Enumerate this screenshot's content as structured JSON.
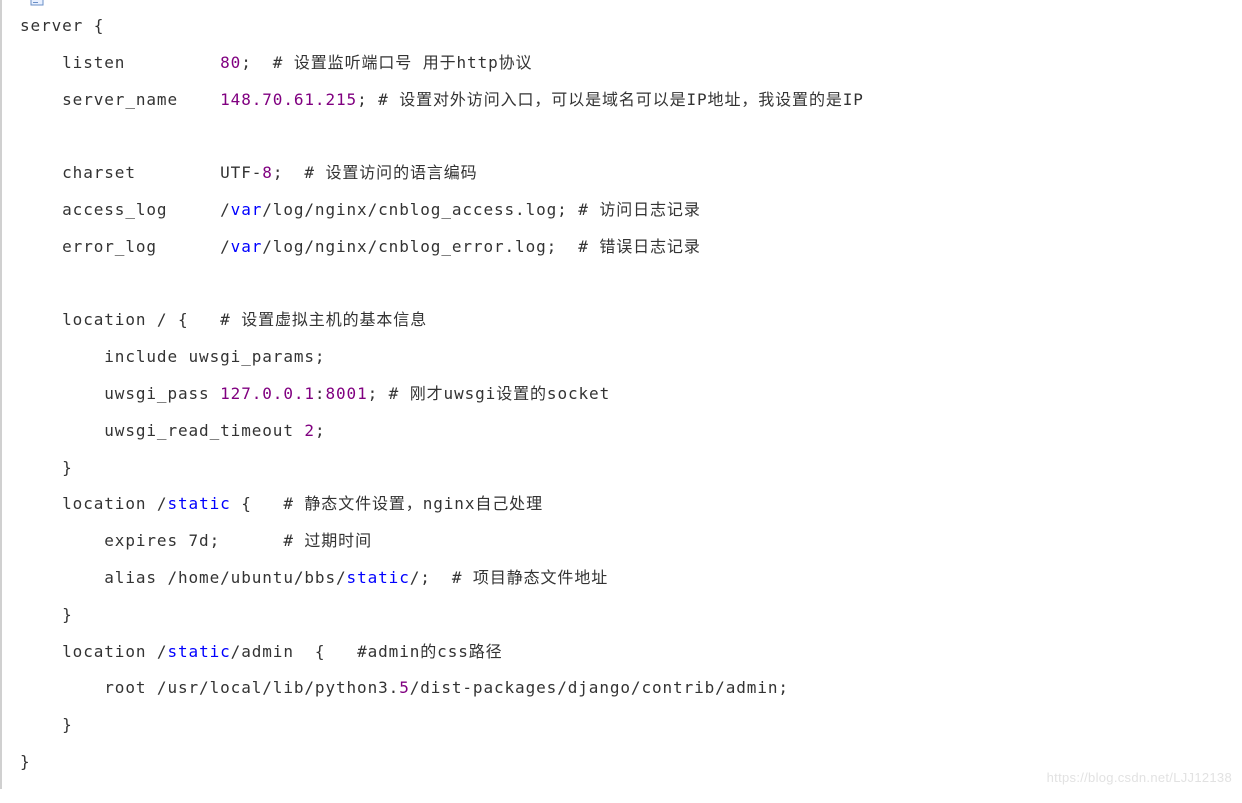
{
  "code": {
    "l1": "server {",
    "l2_a": "    listen         ",
    "l2_num": "80",
    "l2_b": ";  # 设置监听端口号 用于http协议",
    "l3_a": "    server_name    ",
    "l3_num": "148.70.61.215",
    "l3_b": "; # 设置对外访问入口，可以是域名可以是IP地址，我设置的是IP",
    "l4": "",
    "l5_a": "    charset        UTF-",
    "l5_num": "8",
    "l5_b": ";  # 设置访问的语言编码",
    "l6_a": "    access_log     /",
    "l6_kw": "var",
    "l6_b": "/log/nginx/cnblog_access.log; # 访问日志记录",
    "l7_a": "    error_log      /",
    "l7_kw": "var",
    "l7_b": "/log/nginx/cnblog_error.log;  # 错误日志记录",
    "l8": "",
    "l9": "    location / {   # 设置虚拟主机的基本信息",
    "l10": "        include uwsgi_params;",
    "l11_a": "        uwsgi_pass ",
    "l11_num": "127.0.0.1",
    "l11_b": ":",
    "l11_num2": "8001",
    "l11_c": "; # 刚才uwsgi设置的socket",
    "l12_a": "        uwsgi_read_timeout ",
    "l12_num": "2",
    "l12_b": ";",
    "l13": "    }",
    "l14_a": "    location /",
    "l14_kw": "static",
    "l14_b": " {   # 静态文件设置，nginx自己处理",
    "l15": "        expires 7d;      # 过期时间",
    "l16_a": "        alias /home/ubuntu/bbs/",
    "l16_kw": "static",
    "l16_b": "/;  # 项目静态文件地址",
    "l17": "    }",
    "l18_a": "    location /",
    "l18_kw": "static",
    "l18_b": "/admin  {   #admin的css路径",
    "l19_a": "        root /usr/local/lib/python3.",
    "l19_num": "5",
    "l19_b": "/dist-packages/django/contrib/admin;",
    "l20": "    }",
    "l21": "}"
  },
  "watermark": "https://blog.csdn.net/LJJ12138"
}
